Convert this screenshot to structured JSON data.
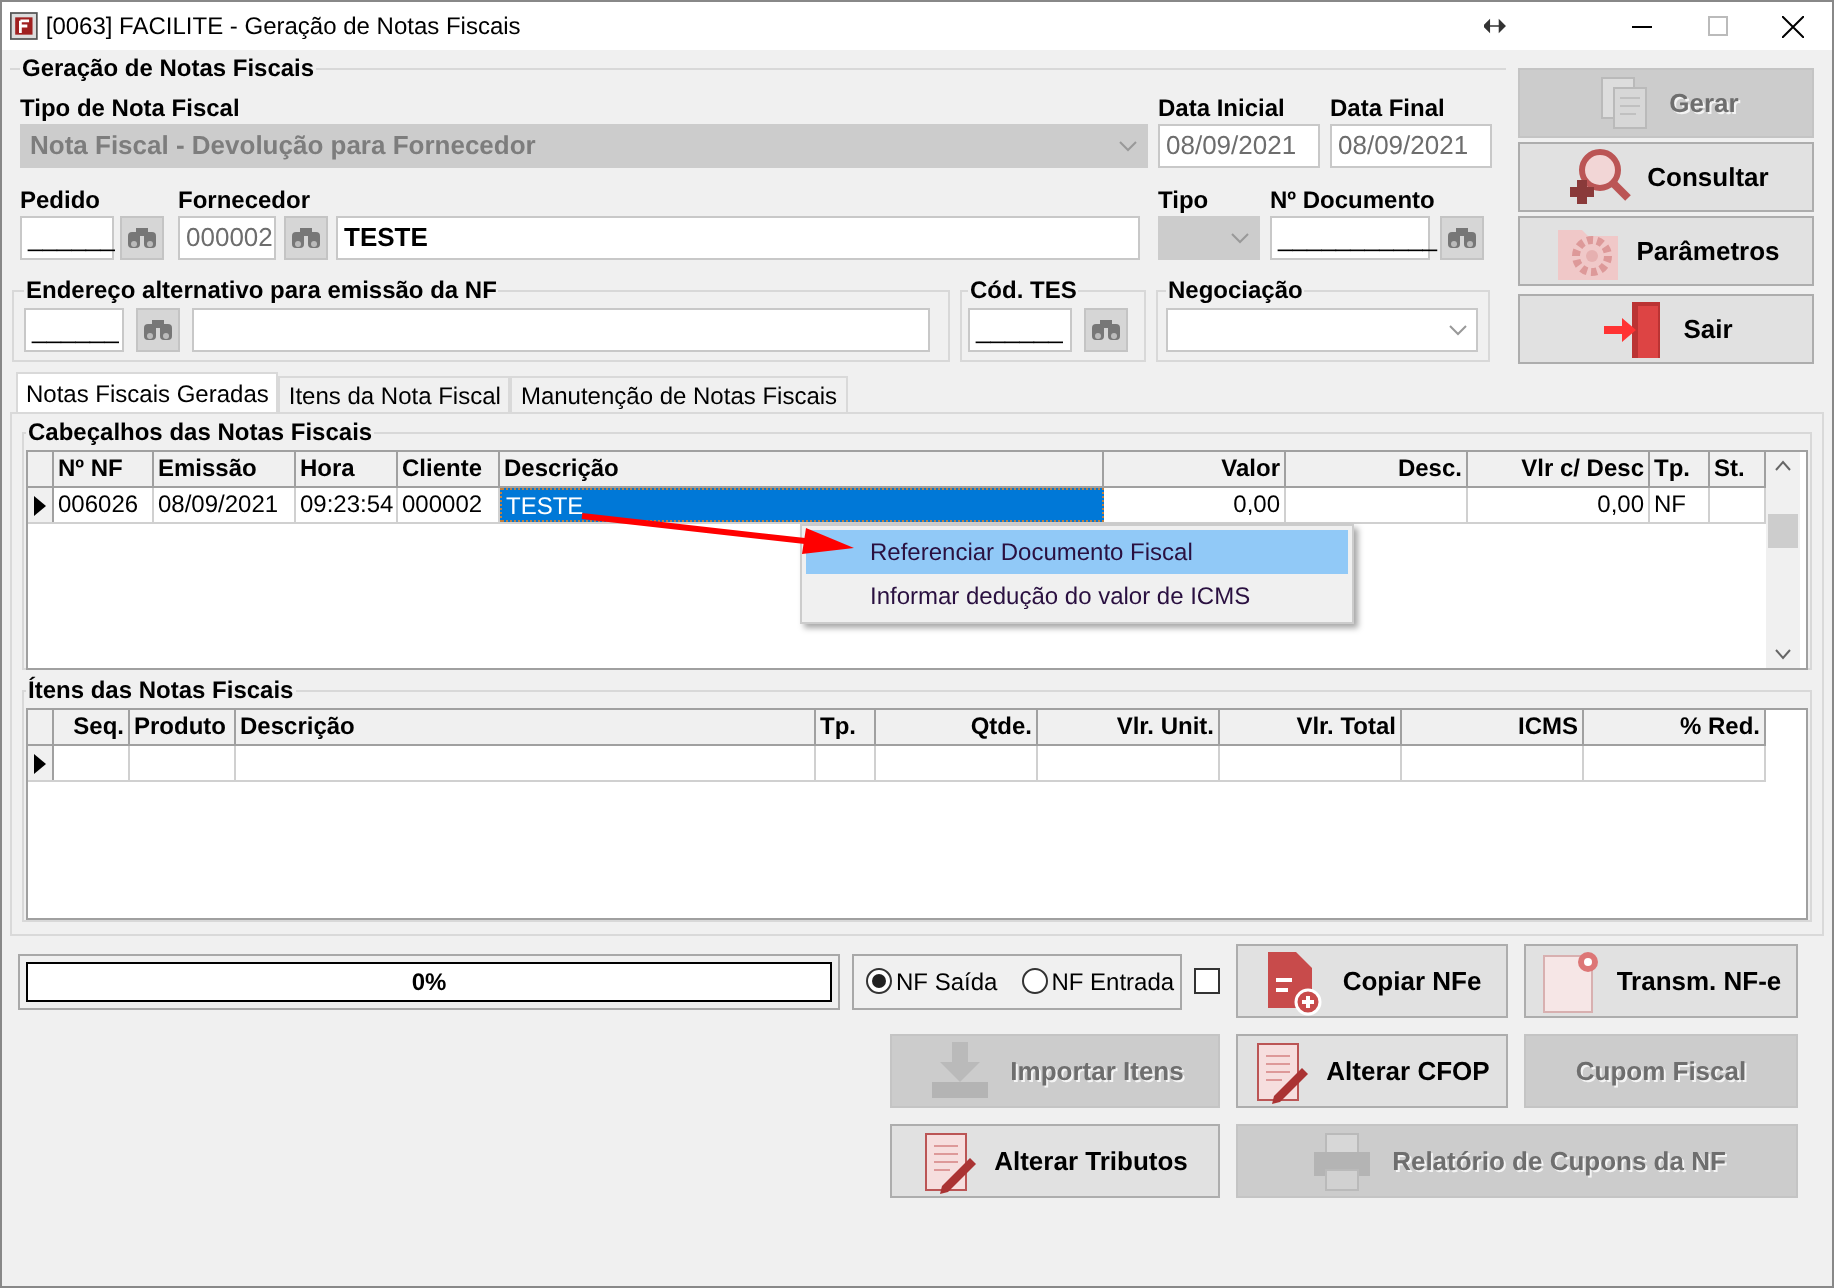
{
  "window": {
    "title": "[0063] FACILITE - Geração de Notas Fiscais"
  },
  "header": {
    "title": "Geração de Notas Fiscais",
    "tipo_nota": {
      "label": "Tipo de Nota Fiscal",
      "value": "Nota Fiscal - Devolução para Fornecedor",
      "disabled": true
    },
    "data_inicial": {
      "label": "Data Inicial",
      "value": "08/09/2021"
    },
    "data_final": {
      "label": "Data Final",
      "value": "08/09/2021"
    },
    "pedido": {
      "label": "Pedido",
      "value": "______"
    },
    "fornecedor": {
      "label": "Fornecedor",
      "code": "000002",
      "name": "TESTE"
    },
    "tipo": {
      "label": "Tipo",
      "disabled": true
    },
    "documento": {
      "label": "Nº Documento",
      "value": "___________"
    },
    "endereco": {
      "title": "Endereço alternativo para emissão da NF",
      "value": "______"
    },
    "cod_tes": {
      "title": "Cód. TES",
      "value": "______"
    },
    "negociacao": {
      "title": "Negociação"
    }
  },
  "side_buttons": [
    {
      "label": "Gerar",
      "kind": "documents",
      "disabled": true
    },
    {
      "label": "Consultar",
      "kind": "search",
      "disabled": false
    },
    {
      "label": "Parâmetros",
      "kind": "gear",
      "disabled": false
    },
    {
      "label": "Sair",
      "kind": "exit",
      "disabled": false
    }
  ],
  "tabs": [
    {
      "label": "Notas Fiscais Geradas",
      "selected": true
    },
    {
      "label": "Itens da Nota Fiscal",
      "selected": false
    },
    {
      "label": "Manutenção de Notas Fiscais",
      "selected": false
    }
  ],
  "headers_table": {
    "title": "Cabeçalhos das Notas Fiscais",
    "columns": [
      {
        "label": "Nº NF"
      },
      {
        "label": "Emissão"
      },
      {
        "label": "Hora"
      },
      {
        "label": "Cliente"
      },
      {
        "label": "Descrição",
        "focused": true
      },
      {
        "label": "Valor"
      },
      {
        "label": "Desc."
      },
      {
        "label": "Vlr c/ Desc"
      },
      {
        "label": "Tp."
      },
      {
        "label": "St."
      }
    ],
    "rows": [
      {
        "selected": true,
        "cells": [
          "006026",
          "08/09/2021",
          "09:23:54",
          "000002",
          "TESTE",
          "0,00",
          null,
          "0,00",
          "NF",
          null
        ]
      }
    ]
  },
  "context_menu": {
    "items": [
      {
        "label": "Referenciar Documento Fiscal",
        "selected": true
      },
      {
        "label": "Informar dedução do valor de ICMS",
        "selected": false
      }
    ]
  },
  "items_table": {
    "title": "Ítens das Notas Fiscais",
    "columns": [
      {
        "label": "Seq."
      },
      {
        "label": "Produto"
      },
      {
        "label": "Descrição"
      },
      {
        "label": "Tp."
      },
      {
        "label": "Qtde."
      },
      {
        "label": "Vlr. Unit."
      },
      {
        "label": "Vlr. Total"
      },
      {
        "label": "ICMS"
      },
      {
        "label": "% Red."
      }
    ],
    "rows": [
      {
        "selected": true
      }
    ]
  },
  "progress": {
    "level": 0,
    "reading": "0%"
  },
  "radios": [
    {
      "label": "NF Saída",
      "selected": true
    },
    {
      "label": "NF Entrada",
      "selected": false
    }
  ],
  "checkbox": {
    "checked": false
  },
  "action_buttons": [
    {
      "label": "Copiar NFe",
      "kind": "file-plus",
      "disabled": false
    },
    {
      "label": "Transm. NF-e",
      "kind": "blank-doc",
      "disabled": false
    },
    {
      "label": "Importar Itens",
      "kind": "import",
      "disabled": true
    },
    {
      "label": "Alterar CFOP",
      "kind": "edit",
      "disabled": false
    },
    {
      "label": "Cupom Fiscal",
      "kind": "none",
      "disabled": true
    },
    {
      "label": "Alterar Tributos",
      "kind": "edit",
      "disabled": false
    },
    {
      "label": "Relatório de Cupons da NF",
      "kind": "printer",
      "disabled": true
    }
  ]
}
